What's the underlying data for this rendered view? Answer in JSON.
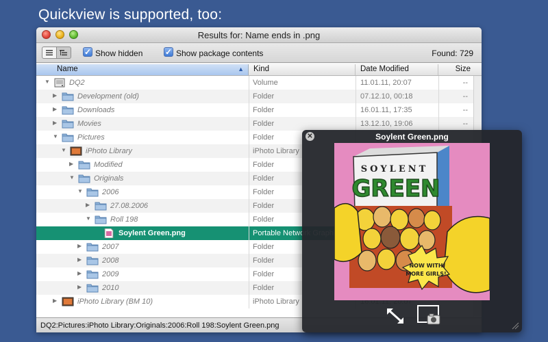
{
  "caption": "Quickview is supported, too:",
  "window": {
    "title": "Results for: Name ends in .png"
  },
  "toolbar": {
    "show_hidden_label": "Show hidden",
    "show_hidden_checked": true,
    "show_package_label": "Show package contents",
    "show_package_checked": true,
    "found_label": "Found: 729"
  },
  "columns": {
    "name": "Name",
    "kind": "Kind",
    "date": "Date Modified",
    "size": "Size"
  },
  "rows": [
    {
      "name": "DQ2",
      "kind": "Volume",
      "date": "11.01.11, 20:07",
      "size": "--",
      "level": 0,
      "disclosure": "open",
      "icon": "drive-icon"
    },
    {
      "name": "Development (old)",
      "kind": "Folder",
      "date": "07.12.10, 00:18",
      "size": "--",
      "level": 1,
      "disclosure": "closed",
      "icon": "folder-icon"
    },
    {
      "name": "Downloads",
      "kind": "Folder",
      "date": "16.01.11, 17:35",
      "size": "--",
      "level": 1,
      "disclosure": "closed",
      "icon": "folder-icon"
    },
    {
      "name": "Movies",
      "kind": "Folder",
      "date": "13.12.10, 19:06",
      "size": "--",
      "level": 1,
      "disclosure": "closed",
      "icon": "folder-icon"
    },
    {
      "name": "Pictures",
      "kind": "Folder",
      "date": "",
      "size": "",
      "level": 1,
      "disclosure": "open",
      "icon": "folder-icon"
    },
    {
      "name": "iPhoto Library",
      "kind": "iPhoto Library",
      "date": "",
      "size": "",
      "level": 2,
      "disclosure": "open",
      "icon": "iphoto-icon"
    },
    {
      "name": "Modified",
      "kind": "Folder",
      "date": "",
      "size": "",
      "level": 3,
      "disclosure": "closed",
      "icon": "folder-icon"
    },
    {
      "name": "Originals",
      "kind": "Folder",
      "date": "",
      "size": "",
      "level": 3,
      "disclosure": "open",
      "icon": "folder-icon"
    },
    {
      "name": "2006",
      "kind": "Folder",
      "date": "",
      "size": "",
      "level": 4,
      "disclosure": "open",
      "icon": "folder-icon"
    },
    {
      "name": "27.08.2006",
      "kind": "Folder",
      "date": "",
      "size": "",
      "level": 5,
      "disclosure": "closed",
      "icon": "folder-icon"
    },
    {
      "name": "Roll 198",
      "kind": "Folder",
      "date": "",
      "size": "",
      "level": 5,
      "disclosure": "open",
      "icon": "folder-icon"
    },
    {
      "name": "Soylent Green.png",
      "kind": "Portable Network Graphics Image",
      "date": "",
      "size": "",
      "level": 6,
      "disclosure": "none",
      "icon": "png-file-icon",
      "selected": true
    },
    {
      "name": "2007",
      "kind": "Folder",
      "date": "",
      "size": "",
      "level": 4,
      "disclosure": "closed",
      "icon": "folder-icon"
    },
    {
      "name": "2008",
      "kind": "Folder",
      "date": "",
      "size": "",
      "level": 4,
      "disclosure": "closed",
      "icon": "folder-icon"
    },
    {
      "name": "2009",
      "kind": "Folder",
      "date": "",
      "size": "",
      "level": 4,
      "disclosure": "closed",
      "icon": "folder-icon"
    },
    {
      "name": "2010",
      "kind": "Folder",
      "date": "",
      "size": "",
      "level": 4,
      "disclosure": "closed",
      "icon": "folder-icon"
    },
    {
      "name": "iPhoto Library (BM 10)",
      "kind": "iPhoto Library",
      "date": "16.01.11, 20:07",
      "size": "",
      "level": 1,
      "disclosure": "closed",
      "icon": "iphoto-icon"
    }
  ],
  "status_path": "DQ2:Pictures:iPhoto Library:Originals:2006:Roll 198:Soylent Green.png",
  "quicklook": {
    "title": "Soylent Green.png",
    "image_text": {
      "brand": "SOYLENT",
      "product": "GREEN",
      "burst_line1": "NOW WITH",
      "burst_line2": "MORE GIRLS!"
    }
  },
  "colors": {
    "desktop": "#3a5a92",
    "selection": "#169173",
    "quicklook_bg": "#24262b"
  }
}
